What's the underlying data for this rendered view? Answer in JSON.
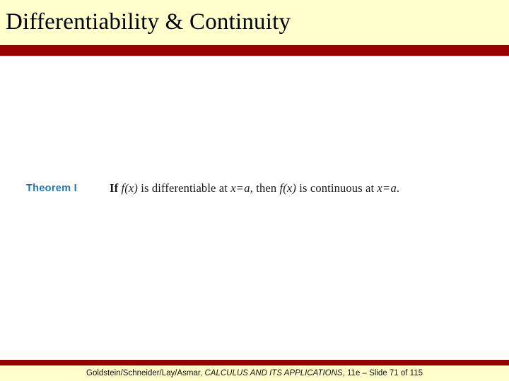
{
  "slide": {
    "title": "Differentiability & Continuity",
    "header_bg": "#FFFFCC",
    "rule_color": "#990000",
    "body_bg": "#FFFFFF"
  },
  "theorem": {
    "label": "Theorem I",
    "label_color": "#2176AE",
    "statement_full": "If f (x) is differentiable at x = a, then f (x) is continuous at x = a.",
    "parts": {
      "lead": "If",
      "fn_one": "f",
      "arg_one": "(x)",
      "mid_one": "is differentiable at",
      "var_x_one": "x",
      "eq_one": "=",
      "var_a_one": "a",
      "comma_then": ", then",
      "fn_two": "f",
      "arg_two": "(x)",
      "mid_two": "is continuous at",
      "var_x_two": "x",
      "eq_two": "=",
      "var_a_two": "a",
      "period": "."
    }
  },
  "footer": {
    "authors": "Goldstein/Schneider/Lay/Asmar,",
    "book_title": "CALCULUS AND ITS APPLICATIONS",
    "edition_slide": ", 11e – Slide 71 of 115",
    "band_bg": "#FFFFCC"
  }
}
